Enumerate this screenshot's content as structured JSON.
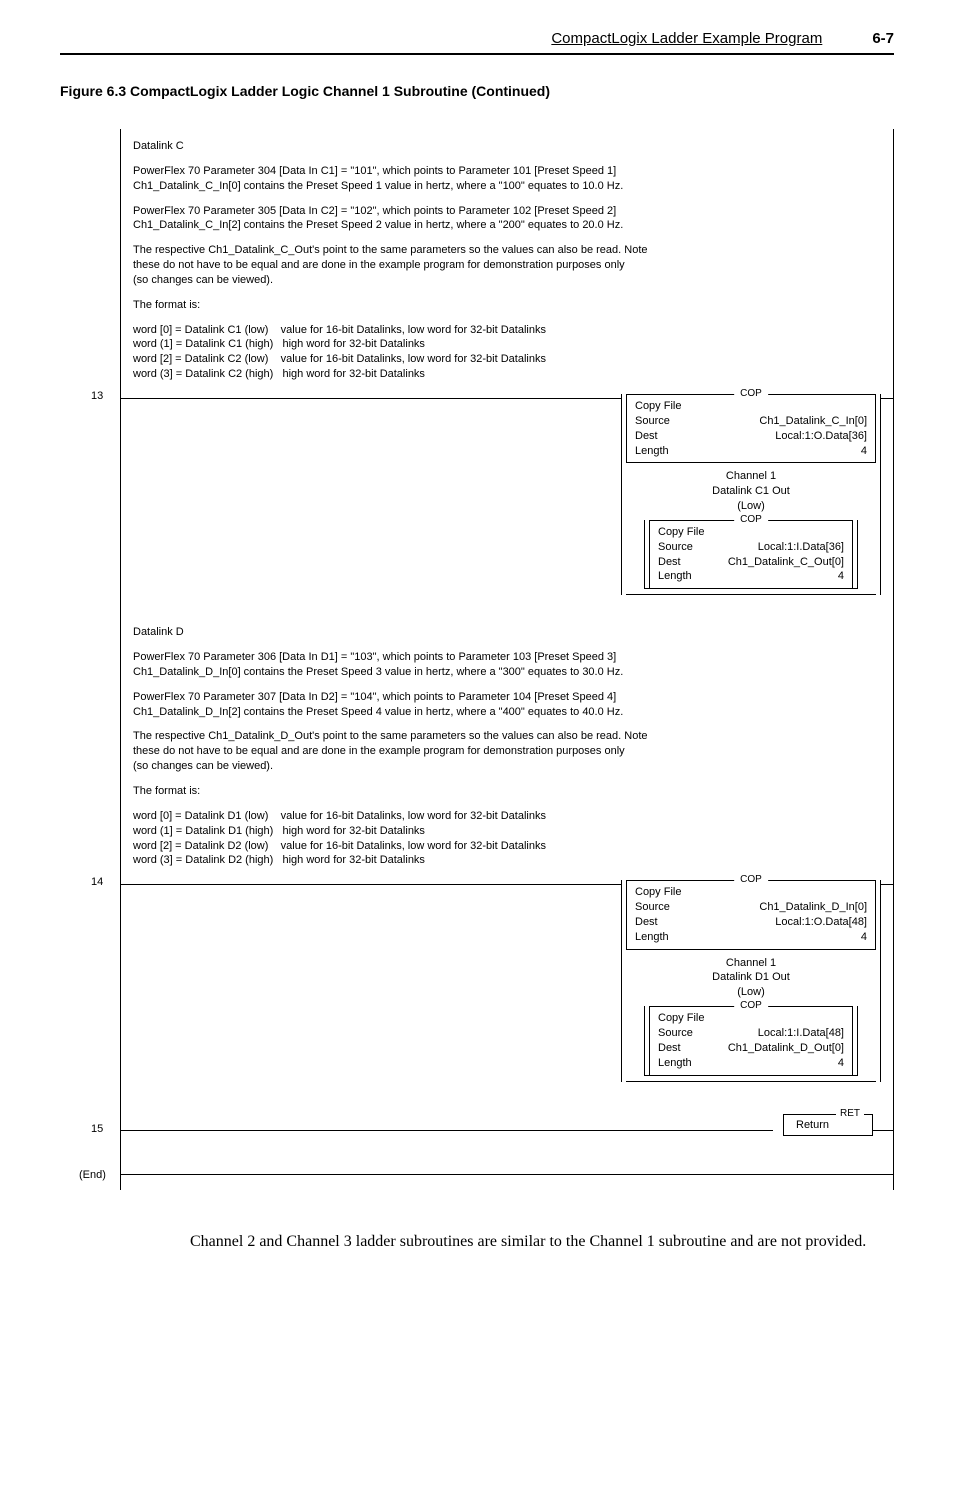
{
  "header": {
    "title": "CompactLogix Ladder Example Program",
    "pagenum": "6-7"
  },
  "figure_caption": "Figure 6.3   CompactLogix Ladder Logic Channel 1 Subroutine (Continued)",
  "rung13": {
    "num": "13",
    "heading": "Datalink C",
    "p1": "PowerFlex 70 Parameter 304 [Data In C1] = \"101\", which points to Parameter 101 [Preset Speed 1]",
    "p1b": "Ch1_Datalink_C_In[0] contains the Preset Speed 1 value in hertz, where a \"100\" equates to 10.0 Hz.",
    "p2": "PowerFlex 70 Parameter 305 [Data In C2] = \"102\", which points to Parameter 102 [Preset Speed 2]",
    "p2b": "Ch1_Datalink_C_In[2] contains the Preset Speed 2 value in hertz, where a \"200\" equates to 20.0 Hz.",
    "p3": "The respective Ch1_Datalink_C_Out's point to the same parameters so the values can also be read.  Note",
    "p3b": " these do not have to be equal and are done in the example program for demonstration purposes only",
    "p3c": "(so changes can be viewed).",
    "fmt": "The format is:",
    "w0": "word [0] = Datalink C1 (low)    value for 16-bit Datalinks, low word for 32-bit Datalinks",
    "w1": "word (1] = Datalink C1 (high)   high word for 32-bit Datalinks",
    "w2": "word [2] = Datalink C2 (low)    value for 16-bit Datalinks, low word for 32-bit Datalinks",
    "w3": "word (3] = Datalink C2 (high)   high word for 32-bit Datalinks",
    "cop1": {
      "tag": "COP",
      "l1": "Copy File",
      "src_l": "Source",
      "src_v": "Ch1_Datalink_C_In[0]",
      "dst_l": "Dest",
      "dst_v": "Local:1:O.Data[36]",
      "len_l": "Length",
      "len_v": "4"
    },
    "branch_labels": {
      "a": "Channel 1",
      "b": "Datalink C1 Out",
      "c": "(Low)"
    },
    "cop2": {
      "tag": "COP",
      "l1": "Copy File",
      "src_l": "Source",
      "src_v": "Local:1:I.Data[36]",
      "dst_l": "Dest",
      "dst_v": "Ch1_Datalink_C_Out[0]",
      "len_l": "Length",
      "len_v": "4"
    }
  },
  "rung14": {
    "num": "14",
    "heading": "Datalink D",
    "p1": "PowerFlex 70 Parameter 306 [Data In D1] = \"103\", which points to Parameter 103 [Preset Speed 3]",
    "p1b": "Ch1_Datalink_D_In[0] contains the Preset Speed 3 value in hertz, where a \"300\" equates to 30.0 Hz.",
    "p2": "PowerFlex 70 Parameter 307 [Data In D2] = \"104\", which points to Parameter 104 [Preset Speed 4]",
    "p2b": "Ch1_Datalink_D_In[2] contains the Preset Speed 4 value in hertz, where a \"400\" equates to 40.0 Hz.",
    "p3": "The respective Ch1_Datalink_D_Out's point to the same parameters so the values can also be read.  Note",
    "p3b": "these do not have to be equal and are done in the example program for demonstration purposes only",
    "p3c": "(so changes can be viewed).",
    "fmt": "The format is:",
    "w0": "word [0] = Datalink D1 (low)    value for 16-bit Datalinks, low word for 32-bit Datalinks",
    "w1": "word (1] = Datalink D1 (high)   high word for 32-bit Datalinks",
    "w2": "word [2] = Datalink D2 (low)    value for 16-bit Datalinks, low word for 32-bit Datalinks",
    "w3": "word (3] = Datalink D2 (high)   high word for 32-bit Datalinks",
    "cop1": {
      "tag": "COP",
      "l1": "Copy File",
      "src_l": "Source",
      "src_v": "Ch1_Datalink_D_In[0]",
      "dst_l": "Dest",
      "dst_v": "Local:1:O.Data[48]",
      "len_l": "Length",
      "len_v": "4"
    },
    "branch_labels": {
      "a": "Channel 1",
      "b": "Datalink D1 Out",
      "c": "(Low)"
    },
    "cop2": {
      "tag": "COP",
      "l1": "Copy File",
      "src_l": "Source",
      "src_v": "Local:1:I.Data[48]",
      "dst_l": "Dest",
      "dst_v": "Ch1_Datalink_D_Out[0]",
      "len_l": "Length",
      "len_v": "4"
    }
  },
  "rung15": {
    "num": "15",
    "ret_tag": "RET",
    "ret_label": "Return"
  },
  "end_label": "(End)",
  "footer": "Channel 2 and Channel 3 ladder subroutines are similar to the Channel 1 subroutine and are not provided."
}
